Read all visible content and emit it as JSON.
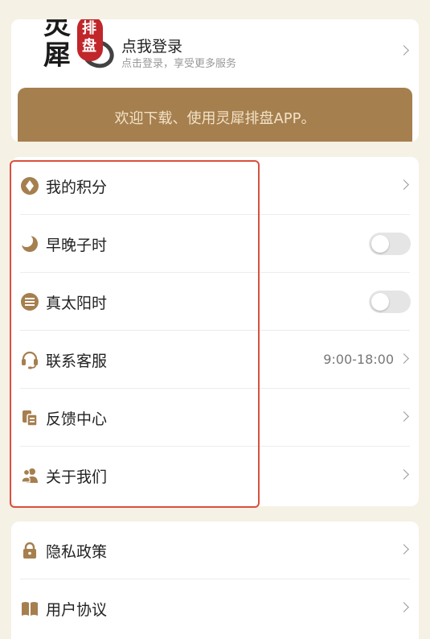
{
  "colors": {
    "accent": "#a67f4f",
    "banner_text": "#f2e2c6",
    "page_bg": "#f5f1e4",
    "highlight": "#d9503f",
    "logo_red": "#c0262a"
  },
  "profile": {
    "logo_chars": [
      "灵",
      "犀",
      "排",
      "盘"
    ],
    "login_title": "点我登录",
    "login_subtitle": "点击登录，享受更多服务",
    "chevron_icon": "chevron-right-icon"
  },
  "banner": {
    "text": "欢迎下载、使用灵犀排盘APP。"
  },
  "menu_group_1": [
    {
      "label": "我的积分",
      "icon": "points-diamond-icon",
      "control": "chevron"
    },
    {
      "label": "早晚子时",
      "icon": "moon-icon",
      "control": "toggle",
      "toggle_on": false
    },
    {
      "label": "真太阳时",
      "icon": "sun-lines-icon",
      "control": "toggle",
      "toggle_on": false
    },
    {
      "label": "联系客服",
      "icon": "headset-icon",
      "control": "chevron",
      "value": "9:00-18:00"
    },
    {
      "label": "反馈中心",
      "icon": "feedback-clipboard-icon",
      "control": "chevron"
    },
    {
      "label": "关于我们",
      "icon": "users-icon",
      "control": "chevron"
    }
  ],
  "menu_group_2": [
    {
      "label": "隐私政策",
      "icon": "lock-icon",
      "control": "chevron"
    },
    {
      "label": "用户协议",
      "icon": "book-icon",
      "control": "chevron"
    }
  ]
}
